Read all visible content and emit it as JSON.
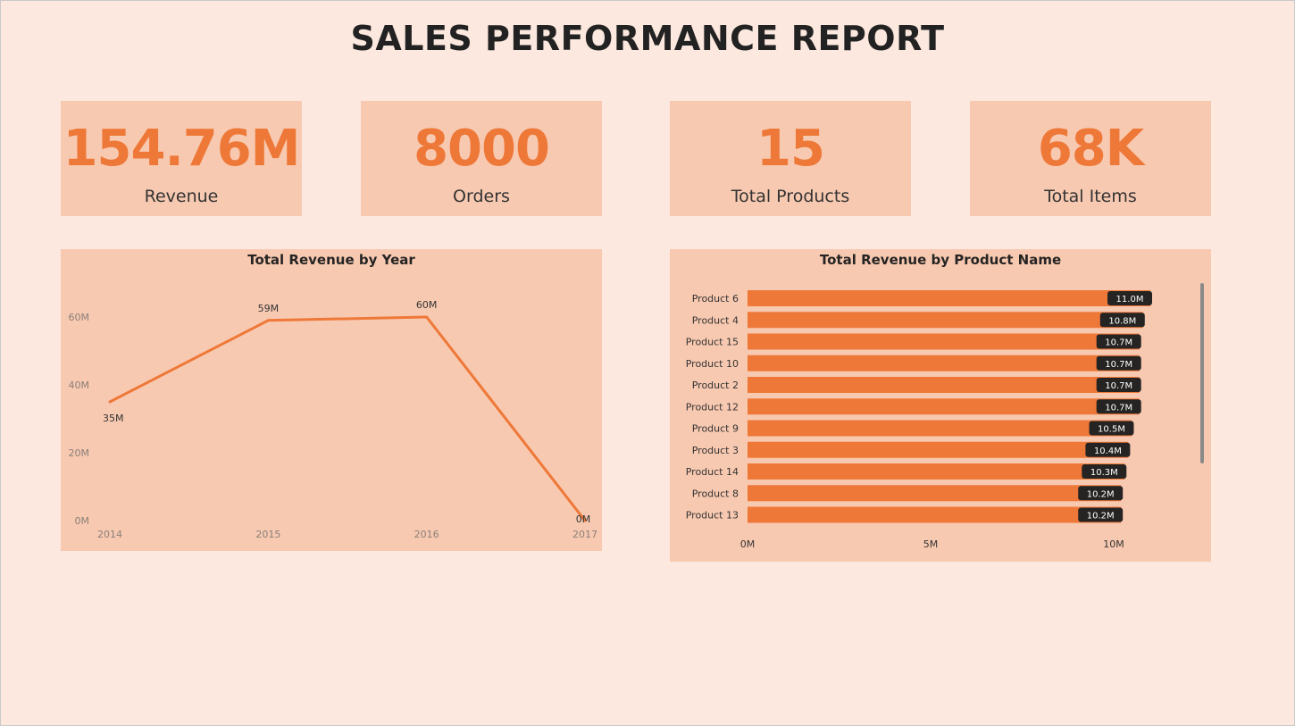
{
  "report": {
    "title": "SALES PERFORMANCE REPORT"
  },
  "kpis": [
    {
      "value": "154.76M",
      "label": "Revenue"
    },
    {
      "value": "8000",
      "label": "Orders"
    },
    {
      "value": "15",
      "label": "Total Products"
    },
    {
      "value": "68K",
      "label": "Total Items"
    }
  ],
  "colors": {
    "background": "#fce8de",
    "card": "#f8c9b1",
    "accent": "#ee7838",
    "title_text": "#222222",
    "data_label_bg": "#252423"
  },
  "chart_data": [
    {
      "type": "line",
      "title": "Total Revenue by Year",
      "xlabel": "",
      "ylabel": "",
      "x": [
        "2014",
        "2015",
        "2016",
        "2017"
      ],
      "series": [
        {
          "values": [
            35,
            59,
            60,
            0
          ],
          "labels": [
            "35M",
            "59M",
            "60M",
            "0M"
          ]
        }
      ],
      "ylim": [
        0,
        60
      ],
      "yticks": [
        0,
        20,
        40,
        60
      ],
      "ytick_labels": [
        "0M",
        "20M",
        "40M",
        "60M"
      ],
      "unit": "M",
      "grid": false,
      "legend": "none"
    },
    {
      "type": "bar",
      "orientation": "horizontal",
      "title": "Total Revenue by Product Name",
      "xlabel": "",
      "ylabel": "",
      "categories": [
        "Product 6",
        "Product 4",
        "Product 15",
        "Product 10",
        "Product 2",
        "Product 12",
        "Product 9",
        "Product 3",
        "Product 14",
        "Product 8",
        "Product 13"
      ],
      "values": [
        11.0,
        10.8,
        10.7,
        10.7,
        10.7,
        10.7,
        10.5,
        10.4,
        10.3,
        10.2,
        10.2
      ],
      "value_labels": [
        "11.0M",
        "10.8M",
        "10.7M",
        "10.7M",
        "10.7M",
        "10.7M",
        "10.5M",
        "10.4M",
        "10.3M",
        "10.2M",
        "10.2M"
      ],
      "xlim": [
        0,
        11
      ],
      "xticks": [
        0,
        5,
        10
      ],
      "xtick_labels": [
        "0M",
        "5M",
        "10M"
      ],
      "unit": "M",
      "grid": false,
      "legend": "none",
      "scrollable": true
    }
  ]
}
